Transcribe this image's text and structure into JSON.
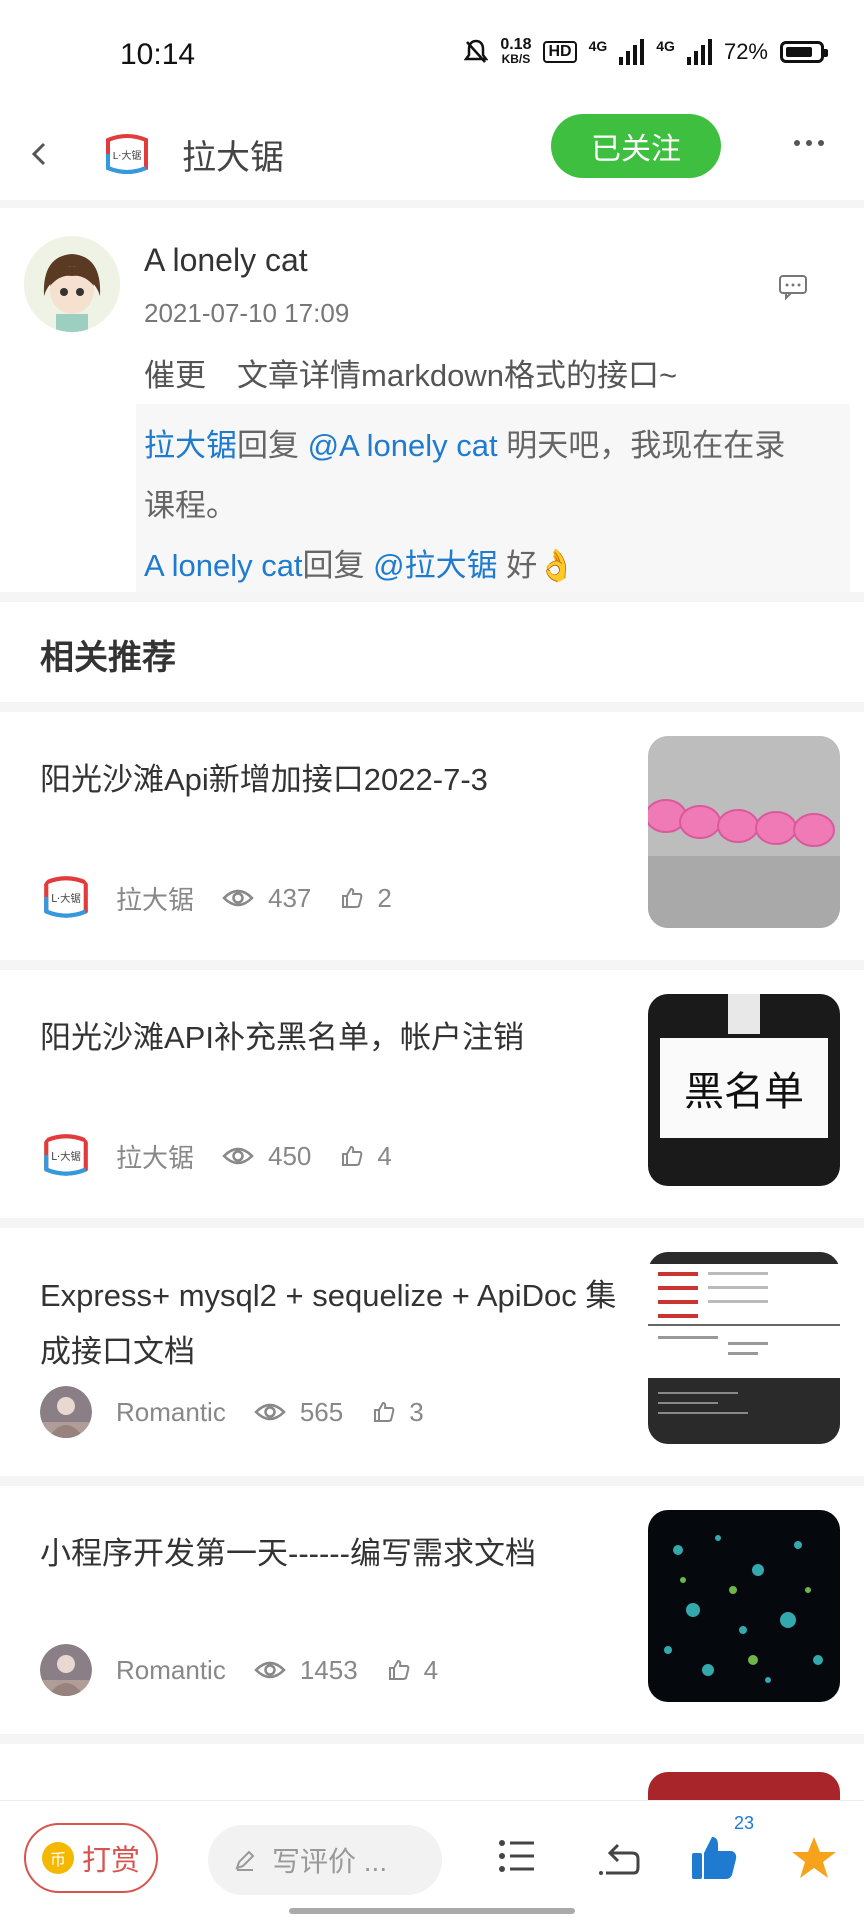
{
  "status_bar": {
    "time": "10:14",
    "net_speed_value": "0.18",
    "net_speed_unit": "KB/S",
    "hd_label": "HD",
    "signal_1_label": "4G",
    "signal_2_label": "4G",
    "battery_text": "72%",
    "icons": [
      "bell-mute-icon",
      "signal-icon",
      "battery-icon"
    ]
  },
  "nav": {
    "title": "拉大锯",
    "follow_label": "已关注",
    "icons": [
      "back-icon",
      "brand-logo",
      "more-icon"
    ]
  },
  "comment": {
    "user": "A lonely cat",
    "time": "2021-07-10 17:09",
    "text": "催更　文章详情markdown格式的接口~",
    "replies": [
      {
        "from": "拉大锯",
        "verb": "回复",
        "to": "@A lonely cat",
        "text": " 明天吧，我现在在录",
        "text_cont": "课程。"
      },
      {
        "from": "A lonely cat",
        "verb": "回复",
        "to": "@拉大锯",
        "text": " 好👌"
      }
    ]
  },
  "section_title": "相关推荐",
  "articles": [
    {
      "title": "阳光沙滩Api新增加接口2022-7-3",
      "author": "拉大锯",
      "views": "437",
      "likes": "2"
    },
    {
      "title": "阳光沙滩API补充黑名单，帐户注销",
      "author": "拉大锯",
      "views": "450",
      "likes": "4",
      "thumb_text": "黑名单"
    },
    {
      "title": "Express+  mysql2 + sequelize + ApiDoc 集成接口文档",
      "author": "Romantic",
      "views": "565",
      "likes": "3"
    },
    {
      "title": "小程序开发第一天------编写需求文档",
      "author": "Romantic",
      "views": "1453",
      "likes": "4"
    }
  ],
  "bottom_bar": {
    "reward_label": "打赏",
    "coin_label": "币",
    "input_placeholder": "写评价 ...",
    "like_count": "23"
  },
  "colors": {
    "accent_green": "#3fbf3f",
    "link_blue": "#1f7bd0",
    "reward_red": "#d9534f",
    "star_orange": "#f7a21b"
  }
}
